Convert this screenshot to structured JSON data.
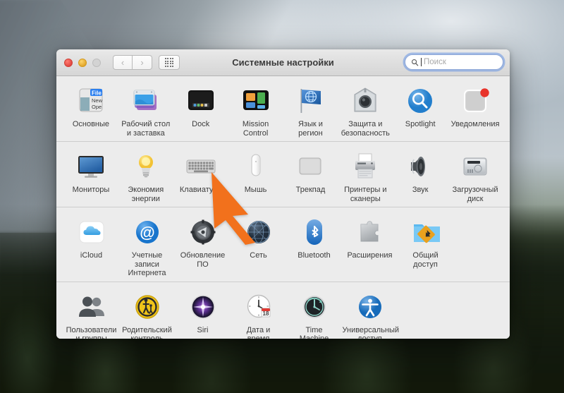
{
  "window": {
    "title": "Системные настройки",
    "traffic_lights": [
      {
        "name": "close",
        "color": "#e0443e"
      },
      {
        "name": "minimize",
        "color": "#e0a52a"
      },
      {
        "name": "zoom",
        "color": "#d3d3d3"
      }
    ],
    "nav": {
      "back": "‹",
      "forward": "›"
    },
    "grid_button": "show-all"
  },
  "search": {
    "placeholder": "Поиск",
    "value": "",
    "focus_ring_color": "#6896e4"
  },
  "rows": [
    {
      "items": [
        {
          "label": "Основные",
          "icon": "general-icon"
        },
        {
          "label": "Рабочий стол\nи заставка",
          "icon": "desktop-screensaver-icon"
        },
        {
          "label": "Dock",
          "icon": "dock-icon"
        },
        {
          "label": "Mission\nControl",
          "icon": "mission-control-icon"
        },
        {
          "label": "Язык и\nрегион",
          "icon": "language-region-icon"
        },
        {
          "label": "Защита и\nбезопасность",
          "icon": "security-privacy-icon"
        },
        {
          "label": "Spotlight",
          "icon": "spotlight-icon"
        },
        {
          "label": "Уведомления",
          "icon": "notifications-icon",
          "badge": true,
          "badge_color": "#e8332a"
        }
      ]
    },
    {
      "items": [
        {
          "label": "Мониторы",
          "icon": "displays-icon"
        },
        {
          "label": "Экономия\nэнергии",
          "icon": "energy-saver-icon"
        },
        {
          "label": "Клавиатура",
          "icon": "keyboard-icon"
        },
        {
          "label": "Мышь",
          "icon": "mouse-icon"
        },
        {
          "label": "Трекпад",
          "icon": "trackpad-icon"
        },
        {
          "label": "Принтеры и\nсканеры",
          "icon": "printers-scanners-icon"
        },
        {
          "label": "Звук",
          "icon": "sound-icon"
        },
        {
          "label": "Загрузочный\nдиск",
          "icon": "startup-disk-icon"
        }
      ]
    },
    {
      "items": [
        {
          "label": "iCloud",
          "icon": "icloud-icon"
        },
        {
          "label": "Учетные записи\nИнтернета",
          "icon": "internet-accounts-icon"
        },
        {
          "label": "Обновление\nПО",
          "icon": "software-update-icon"
        },
        {
          "label": "Сеть",
          "icon": "network-icon"
        },
        {
          "label": "Bluetooth",
          "icon": "bluetooth-icon"
        },
        {
          "label": "Расширения",
          "icon": "extensions-icon"
        },
        {
          "label": "Общий\nдоступ",
          "icon": "sharing-icon"
        }
      ]
    },
    {
      "items": [
        {
          "label": "Пользователи\nи группы",
          "icon": "users-groups-icon"
        },
        {
          "label": "Родительский\nконтроль",
          "icon": "parental-controls-icon"
        },
        {
          "label": "Siri",
          "icon": "siri-icon"
        },
        {
          "label": "Дата и\nвремя",
          "icon": "date-time-icon"
        },
        {
          "label": "Time\nMachine",
          "icon": "time-machine-icon"
        },
        {
          "label": "Универсальный\nдоступ",
          "icon": "accessibility-icon"
        }
      ]
    }
  ],
  "cursor": {
    "type": "arrow-pointer",
    "color": "#f2711c"
  }
}
